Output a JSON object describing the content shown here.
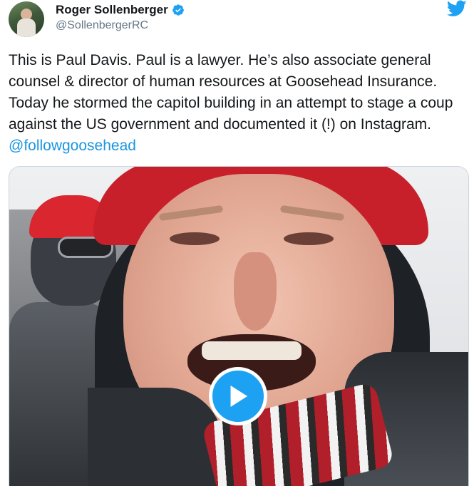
{
  "author": {
    "display_name": "Roger Sollenberger",
    "handle": "@SollenbergerRC",
    "verified": true
  },
  "tweet": {
    "text": "This is Paul Davis. Paul is a lawyer. He’s also associate general counsel & director of human resources at Goosehead Insurance. Today he stormed the capitol building in an attempt to stage a coup against the US government and documented it (!) on Instagram. ",
    "mention": "@followgoosehead"
  },
  "icons": {
    "brand": "twitter-bird-icon",
    "verified": "verified-badge-icon",
    "media_play": "play-icon"
  },
  "colors": {
    "twitter_blue": "#1da1f2",
    "mention_blue": "#1b95e0",
    "text": "#14171a",
    "secondary_text": "#657786"
  }
}
